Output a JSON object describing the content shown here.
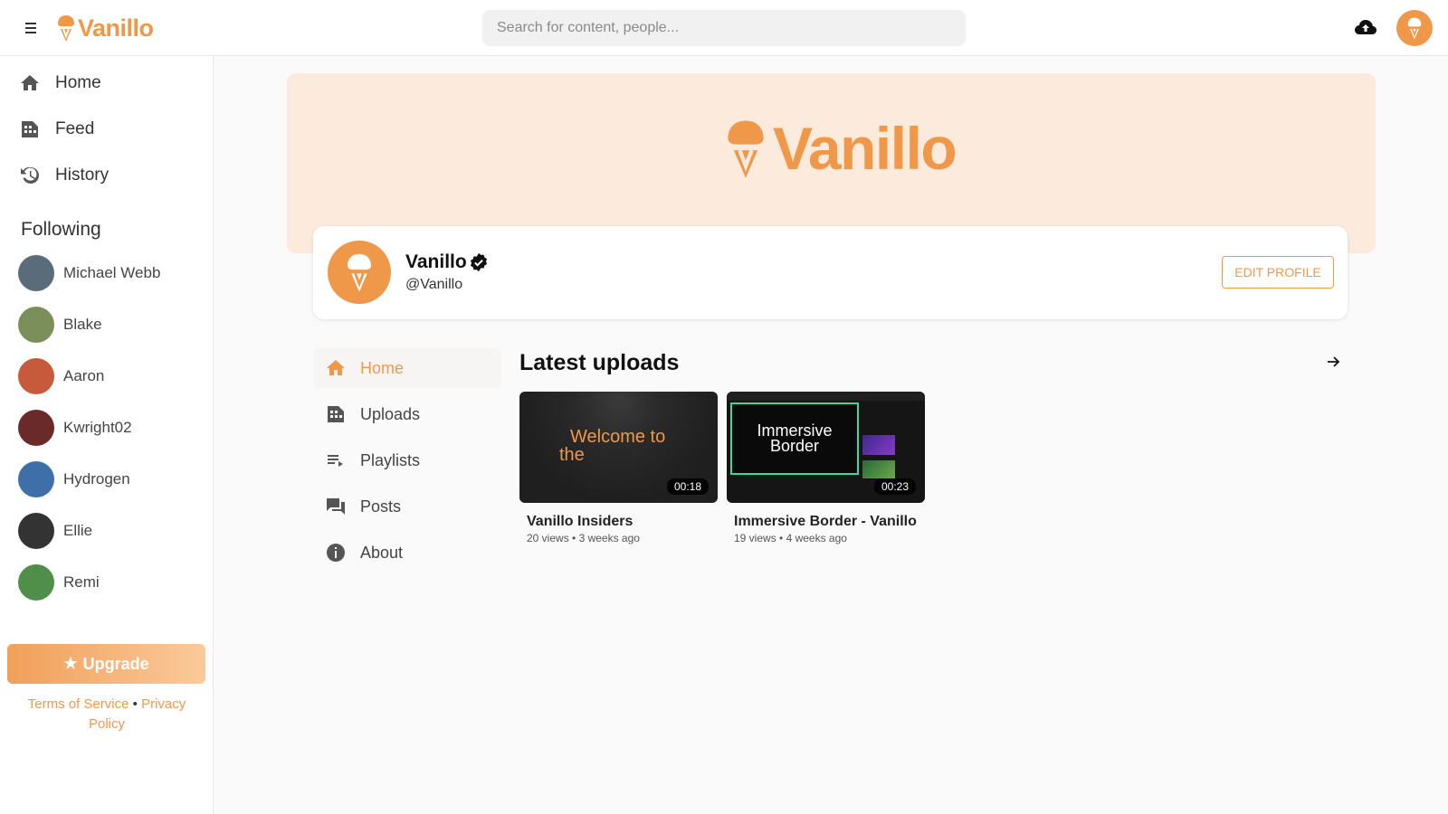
{
  "app": {
    "name": "Vanillo",
    "brand_color": "#f0984a"
  },
  "topbar": {
    "search_placeholder": "Search for content, people...",
    "menu_icon": "hamburger-icon",
    "upload_icon": "cloud-upload-icon"
  },
  "sidebar": {
    "nav": [
      {
        "label": "Home",
        "icon": "home-icon"
      },
      {
        "label": "Feed",
        "icon": "feed-icon"
      },
      {
        "label": "History",
        "icon": "history-icon"
      }
    ],
    "following_title": "Following",
    "following": [
      {
        "name": "Michael Webb",
        "color": "#5a6b7a"
      },
      {
        "name": "Blake",
        "color": "#7a8f5a"
      },
      {
        "name": "Aaron",
        "color": "#c75a3a"
      },
      {
        "name": "Kwright02",
        "color": "#6a2a2a"
      },
      {
        "name": "Hydrogen",
        "color": "#3f6fa8"
      },
      {
        "name": "Ellie",
        "color": "#333333"
      },
      {
        "name": "Remi",
        "color": "#4f8f4a"
      }
    ],
    "upgrade_label": "Upgrade",
    "terms_label": "Terms of Service",
    "privacy_label": "Privacy Policy",
    "separator": "•"
  },
  "profile": {
    "name": "Vanillo",
    "handle": "@Vanillo",
    "edit_label": "EDIT PROFILE"
  },
  "channel_nav": [
    {
      "label": "Home",
      "icon": "home-icon",
      "active": true
    },
    {
      "label": "Uploads",
      "icon": "uploads-icon",
      "active": false
    },
    {
      "label": "Playlists",
      "icon": "playlist-icon",
      "active": false
    },
    {
      "label": "Posts",
      "icon": "posts-icon",
      "active": false
    },
    {
      "label": "About",
      "icon": "info-icon",
      "active": false
    }
  ],
  "latest": {
    "title": "Latest uploads",
    "videos": [
      {
        "title": "Vanillo Insiders",
        "views": "20 views",
        "age": "3 weeks ago",
        "duration": "00:18",
        "thumb_text_line1": "Welcome to",
        "thumb_text_line2": "the"
      },
      {
        "title": "Immersive Border - Vanillo",
        "views": "19 views",
        "age": "4 weeks ago",
        "duration": "00:23",
        "thumb_text_line1": "Immersive",
        "thumb_text_line2": "Border"
      }
    ]
  }
}
